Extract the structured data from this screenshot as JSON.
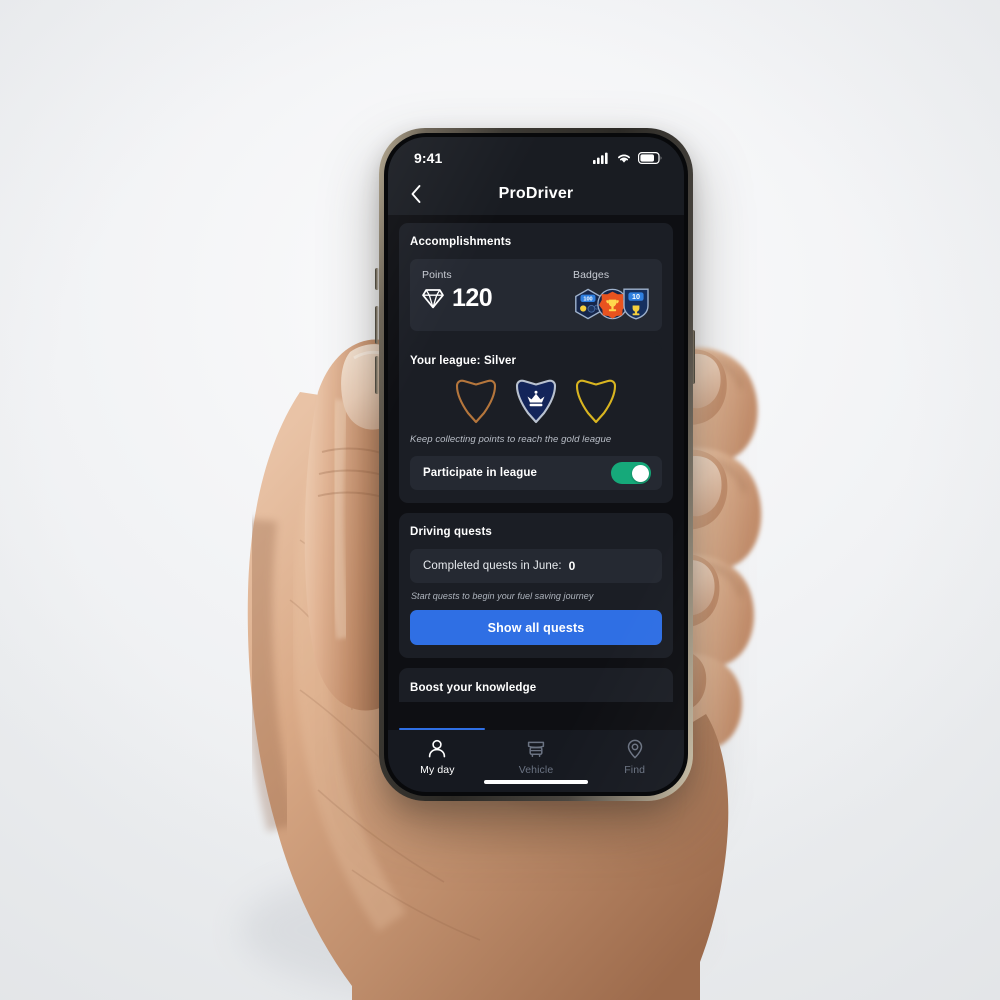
{
  "scene": {
    "background_color": "#f2f3f5",
    "device_frame_color": "#6d6558",
    "description": "hand-holding-phone-mockup"
  },
  "status_bar": {
    "time": "9:41",
    "icons": [
      "cellular-signal-icon",
      "wifi-icon",
      "battery-icon"
    ]
  },
  "nav_bar": {
    "back_icon": "chevron-left-icon",
    "title": "ProDriver"
  },
  "accomplishments": {
    "title": "Accomplishments",
    "points": {
      "label": "Points",
      "icon": "diamond-icon",
      "value": "120"
    },
    "badges": {
      "label": "Badges",
      "items": [
        {
          "name": "badge-100-hexagon",
          "value": "100",
          "shape": "hexagon",
          "color": "#1b3a73",
          "accent": "#2f7fe0"
        },
        {
          "name": "badge-trophy-flower",
          "value": "",
          "shape": "flower",
          "color": "#e8531f",
          "accent": "#ffd84d"
        },
        {
          "name": "badge-10-shield",
          "value": "10",
          "shape": "shield",
          "color": "#16305f",
          "accent": "#2f7fe0"
        }
      ]
    }
  },
  "league": {
    "title": "Your league: Silver",
    "tiers": [
      {
        "name": "bronze-shield",
        "state": "locked",
        "color": "#b5763c"
      },
      {
        "name": "silver-shield",
        "state": "current",
        "color": "#b9c2d0",
        "fill": "#13255a",
        "icon": "crown-icon"
      },
      {
        "name": "gold-shield",
        "state": "locked",
        "color": "#d9b520"
      }
    ],
    "hint": "Keep collecting points to reach the gold league",
    "toggle": {
      "label": "Participate in league",
      "state": "on",
      "on_color": "#16a97a"
    }
  },
  "quests": {
    "title": "Driving quests",
    "completed_label": "Completed quests in June:",
    "completed_count": "0",
    "hint": "Start quests to begin your fuel saving journey",
    "button_label": "Show all quests",
    "button_color": "#2f6fe4"
  },
  "boost": {
    "title": "Boost your knowledge"
  },
  "tab_bar": {
    "tabs": [
      {
        "id": "my-day",
        "label": "My day",
        "icon": "person-icon",
        "active": true
      },
      {
        "id": "vehicle",
        "label": "Vehicle",
        "icon": "truck-icon",
        "active": false
      },
      {
        "id": "find",
        "label": "Find",
        "icon": "location-pin-icon",
        "active": false
      }
    ]
  }
}
